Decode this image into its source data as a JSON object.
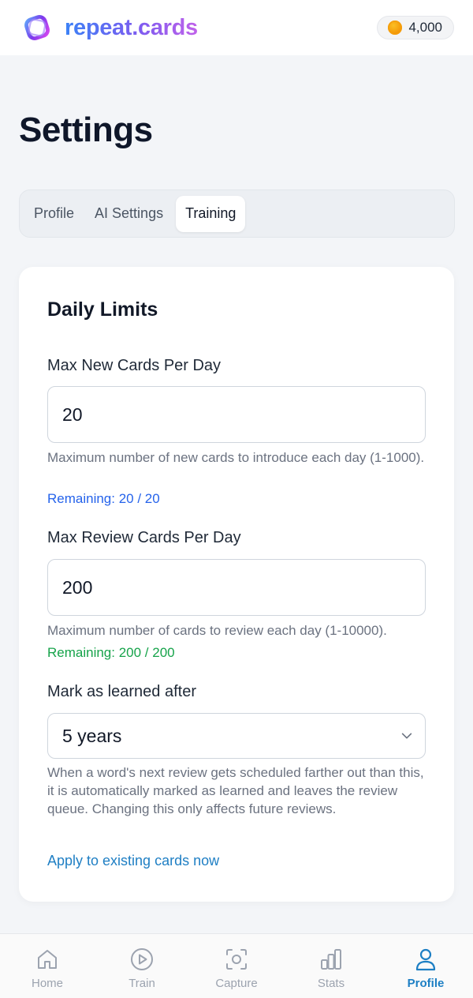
{
  "header": {
    "brand": "repeat.cards",
    "logo_icon": "repeat-cards-logo-icon",
    "coins": "4,000"
  },
  "page": {
    "title": "Settings"
  },
  "tabs": [
    {
      "label": "Profile",
      "active": false
    },
    {
      "label": "AI Settings",
      "active": false
    },
    {
      "label": "Training",
      "active": true
    }
  ],
  "daily_limits": {
    "title": "Daily Limits",
    "new_cards": {
      "label": "Max New Cards Per Day",
      "value": "20",
      "help": "Maximum number of new cards to introduce each day (1-1000).",
      "remaining": "Remaining: 20 / 20"
    },
    "review_cards": {
      "label": "Max Review Cards Per Day",
      "value": "200",
      "help": "Maximum number of cards to review each day (1-10000).",
      "remaining": "Remaining: 200 / 200"
    },
    "learned_after": {
      "label": "Mark as learned after",
      "selected": "5 years",
      "help": "When a word's next review gets scheduled farther out than this, it is automatically marked as learned and leaves the review queue. Changing this only affects future reviews."
    },
    "apply_link": "Apply to existing cards now"
  },
  "bottom_nav": [
    {
      "label": "Home",
      "icon": "home-icon",
      "active": false
    },
    {
      "label": "Train",
      "icon": "play-icon",
      "active": false
    },
    {
      "label": "Capture",
      "icon": "camera-icon",
      "active": false
    },
    {
      "label": "Stats",
      "icon": "bar-chart-icon",
      "active": false
    },
    {
      "label": "Profile",
      "icon": "user-icon",
      "active": true
    }
  ],
  "colors": {
    "accent": "#1d7fc4",
    "remaining_new": "#2563eb",
    "remaining_review": "#16a34a",
    "coin": "#f59e0b"
  }
}
